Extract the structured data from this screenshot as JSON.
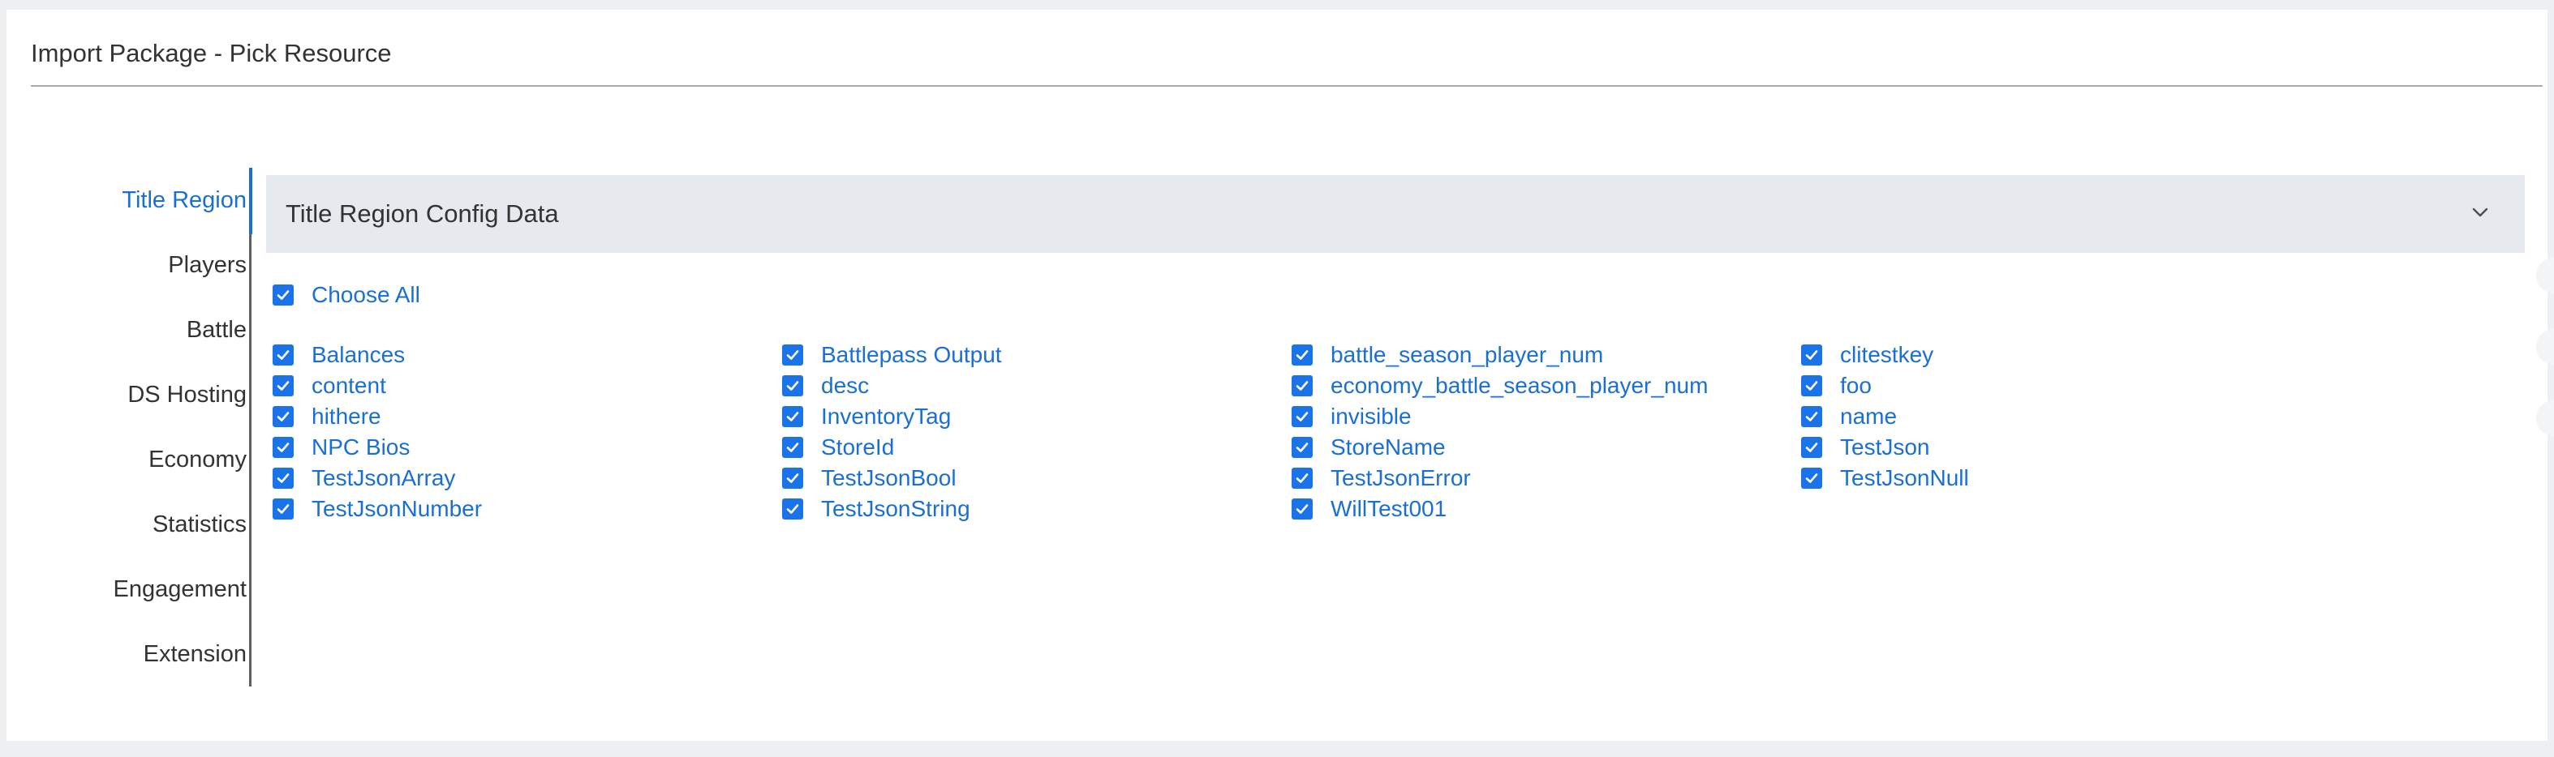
{
  "page": {
    "title": "Import Package - Pick Resource"
  },
  "nav": {
    "items": [
      {
        "label": "Title Region",
        "active": true
      },
      {
        "label": "Players",
        "active": false
      },
      {
        "label": "Battle",
        "active": false
      },
      {
        "label": "DS Hosting",
        "active": false
      },
      {
        "label": "Economy",
        "active": false
      },
      {
        "label": "Statistics",
        "active": false
      },
      {
        "label": "Engagement",
        "active": false
      },
      {
        "label": "Extension",
        "active": false
      }
    ]
  },
  "section": {
    "title": "Title Region Config Data",
    "expand_icon": "chevron-down-icon"
  },
  "choose_all": {
    "label": "Choose All",
    "checked": true
  },
  "resources": {
    "columns": [
      [
        {
          "label": "Balances",
          "checked": true
        },
        {
          "label": "content",
          "checked": true
        },
        {
          "label": "hithere",
          "checked": true
        },
        {
          "label": "NPC Bios",
          "checked": true
        },
        {
          "label": "TestJsonArray",
          "checked": true
        },
        {
          "label": "TestJsonNumber",
          "checked": true
        }
      ],
      [
        {
          "label": "Battlepass Output",
          "checked": true
        },
        {
          "label": "desc",
          "checked": true
        },
        {
          "label": "InventoryTag",
          "checked": true
        },
        {
          "label": "StoreId",
          "checked": true
        },
        {
          "label": "TestJsonBool",
          "checked": true
        },
        {
          "label": "TestJsonString",
          "checked": true
        }
      ],
      [
        {
          "label": "battle_season_player_num",
          "checked": true
        },
        {
          "label": "economy_battle_season_player_num",
          "checked": true
        },
        {
          "label": "invisible",
          "checked": true
        },
        {
          "label": "StoreName",
          "checked": true
        },
        {
          "label": "TestJsonError",
          "checked": true
        },
        {
          "label": "WillTest001",
          "checked": true
        }
      ],
      [
        {
          "label": "clitestkey",
          "checked": true
        },
        {
          "label": "foo",
          "checked": true
        },
        {
          "label": "name",
          "checked": true
        },
        {
          "label": "TestJson",
          "checked": true
        },
        {
          "label": "TestJsonNull",
          "checked": true
        }
      ]
    ]
  },
  "colors": {
    "accent": "#1a6fd4",
    "checkbox": "#1a73e8",
    "text": "#333333",
    "header_bg": "#e6e9ed",
    "page_bg": "#eeeff0"
  }
}
